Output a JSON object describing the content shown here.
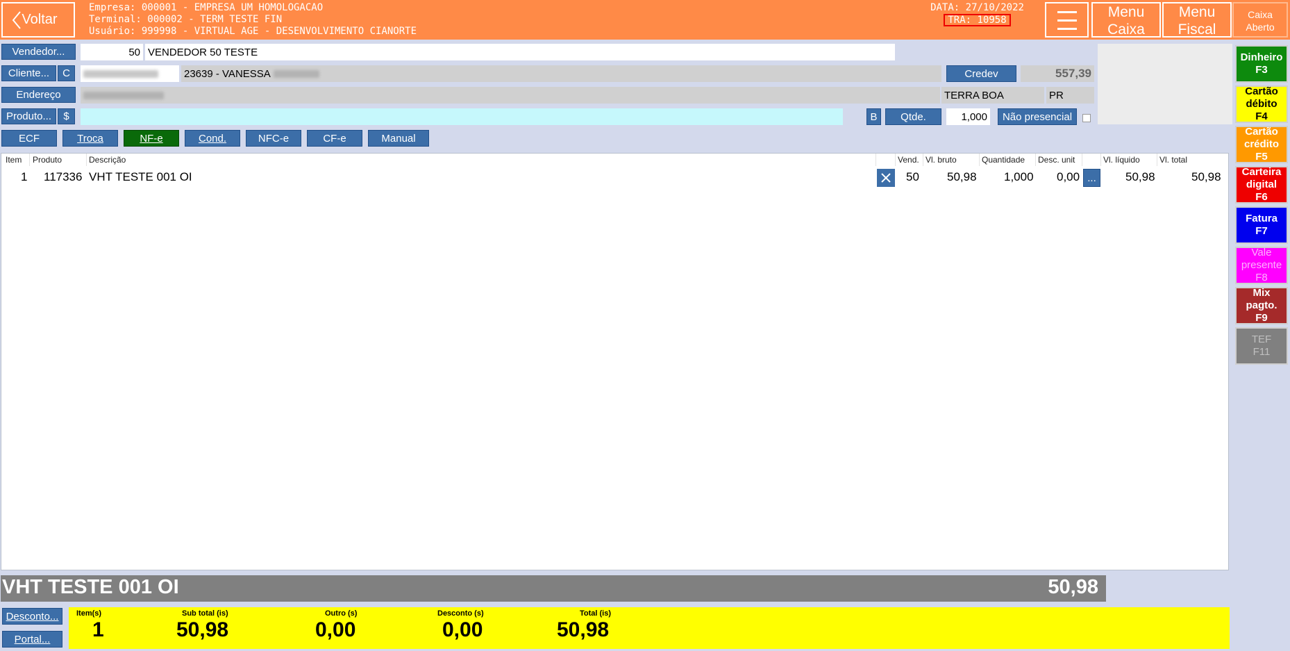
{
  "header": {
    "back_label": "Voltar",
    "empresa": "Empresa: 000001 - EMPRESA UM HOMOLOGACAO",
    "terminal": "Terminal: 000002 - TERM TESTE FIN",
    "usuario": "Usuário: 999998 - VIRTUAL AGE - DESENVOLVIMENTO CIANORTE",
    "data": "DATA: 27/10/2022",
    "tra": "TRA: 10958",
    "menu_caixa": [
      "Menu",
      "Caixa"
    ],
    "menu_fiscal": [
      "Menu",
      "Fiscal"
    ],
    "caixa_status": [
      "Caixa",
      "Aberto"
    ]
  },
  "form": {
    "vendedor_label": "Vendedor...",
    "vendedor_code": "50",
    "vendedor_name": "VENDEDOR 50 TESTE",
    "cliente_label": "Cliente...",
    "cliente_c": "C",
    "cliente_name": "23639 - VANESSA",
    "credev_label": "Credev",
    "credev_value": "557,39",
    "endereco_label": "Endereço",
    "cidade": "TERRA BOA",
    "uf": "PR",
    "produto_label": "Produto...",
    "produto_dollar": "$",
    "b_label": "B",
    "qtde_label": "Qtde.",
    "qtde_value": "1,000",
    "nao_presencial": "Não presencial"
  },
  "doc_buttons": [
    "ECF",
    "Troca",
    "NF-e",
    "Cond.",
    "NFC-e",
    "CF-e",
    "Manual"
  ],
  "grid": {
    "headers": {
      "item": "Item",
      "produto": "Produto",
      "descricao": "Descrição",
      "vend": "Vend.",
      "vl_bruto": "Vl. bruto",
      "quantidade": "Quantidade",
      "desc_unit": "Desc. unit",
      "vl_liquido": "Vl. líquido",
      "vl_total": "Vl. total"
    },
    "rows": [
      {
        "item": "1",
        "produto": "117336",
        "descricao": "VHT TESTE 001 OI",
        "vend": "50",
        "vl_bruto": "50,98",
        "quantidade": "1,000",
        "desc_unit": "0,00",
        "more": "...",
        "vl_liquido": "50,98",
        "vl_total": "50,98"
      }
    ]
  },
  "payments": [
    {
      "label": [
        "Dinheiro",
        "F3"
      ],
      "bg": "#0d8a0d",
      "fg": "#ffffff"
    },
    {
      "label": [
        "Cartão",
        "débito",
        "F4"
      ],
      "bg": "#ffff00",
      "fg": "#000000"
    },
    {
      "label": [
        "Cartão",
        "crédito",
        "F5"
      ],
      "bg": "#ff9900",
      "fg": "#ffffff"
    },
    {
      "label": [
        "Carteira",
        "digital",
        "F6"
      ],
      "bg": "#ee0000",
      "fg": "#ffffff"
    },
    {
      "label": [
        "Fatura",
        "F7"
      ],
      "bg": "#0000ee",
      "fg": "#ffffff"
    },
    {
      "label": [
        "Vale",
        "presente",
        "F8"
      ],
      "bg": "#ff00ff",
      "fg": "#ffb0ff"
    },
    {
      "label": [
        "Mix",
        "pagto.",
        "F9"
      ],
      "bg": "#a52a2a",
      "fg": "#ffffff"
    },
    {
      "label": [
        "TEF",
        "F11"
      ],
      "bg": "#808080",
      "fg": "#bfbfbf"
    }
  ],
  "status": {
    "product": "VHT TESTE 001 OI",
    "value": "50,98"
  },
  "bottom": {
    "desconto_label": "Desconto...",
    "portal_label": "Portal...",
    "itens_label": "Item(s)",
    "itens_value": "1",
    "subtotal_label": "Sub total (is)",
    "subtotal_value": "50,98",
    "outro_label": "Outro (s)",
    "outro_value": "0,00",
    "desconto_s_label": "Desconto (s)",
    "desconto_s_value": "0,00",
    "total_label": "Total (is)",
    "total_value": "50,98"
  },
  "colors": {
    "header": "#ff8a47",
    "button_blue": "#3c6ea8",
    "nfe_active": "#0a6a0a",
    "totals_bg": "#ffff00"
  }
}
